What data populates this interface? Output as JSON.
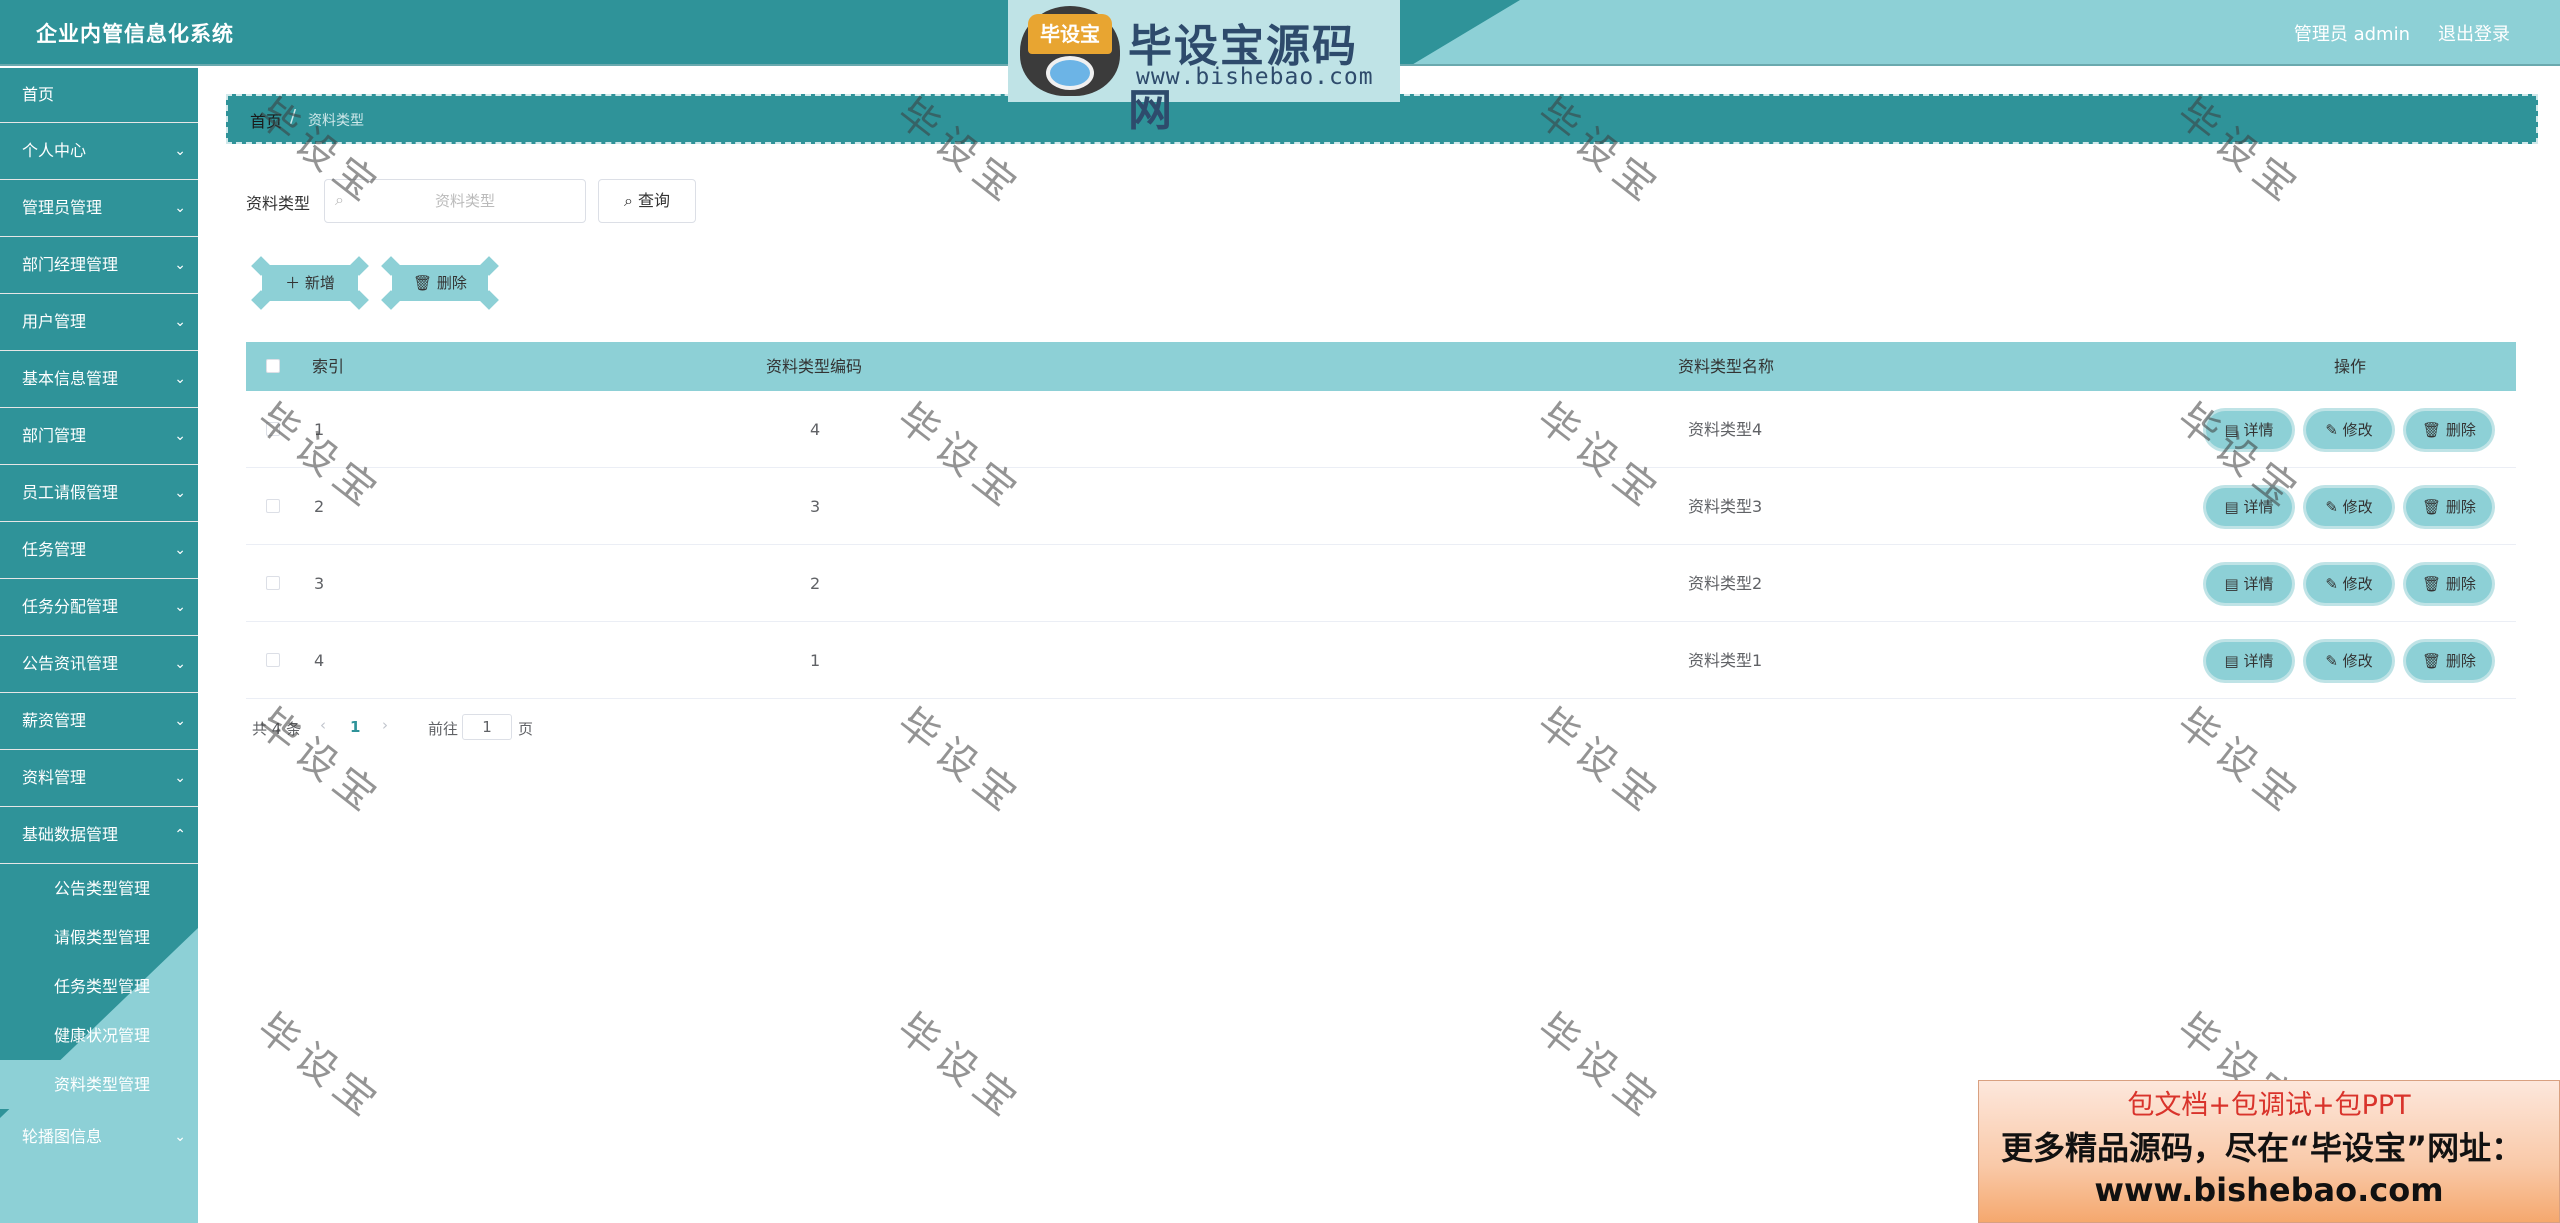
{
  "header": {
    "app_title": "企业内管信息化系统",
    "user_info": "管理员 admin",
    "logout": "退出登录"
  },
  "logo": {
    "badge": "毕设宝",
    "name": "毕设宝源码网",
    "url": "www.bishebao.com"
  },
  "sidebar": {
    "items": [
      {
        "label": "首页"
      },
      {
        "label": "个人中心"
      },
      {
        "label": "管理员管理"
      },
      {
        "label": "部门经理管理"
      },
      {
        "label": "用户管理"
      },
      {
        "label": "基本信息管理"
      },
      {
        "label": "部门管理"
      },
      {
        "label": "员工请假管理"
      },
      {
        "label": "任务管理"
      },
      {
        "label": "任务分配管理"
      },
      {
        "label": "公告资讯管理"
      },
      {
        "label": "薪资管理"
      },
      {
        "label": "资料管理"
      },
      {
        "label": "基础数据管理"
      }
    ],
    "subitems": [
      {
        "label": "公告类型管理"
      },
      {
        "label": "请假类型管理"
      },
      {
        "label": "任务类型管理"
      },
      {
        "label": "健康状况管理"
      },
      {
        "label": "资料类型管理"
      }
    ],
    "last_item": {
      "label": "轮播图信息"
    },
    "chevron": "⌄"
  },
  "breadcrumb": {
    "home": "首页",
    "separator": "/",
    "current": "资料类型"
  },
  "search": {
    "label": "资料类型",
    "placeholder": "资料类型",
    "query_button": "查询"
  },
  "actions": {
    "add_label": "新增",
    "delete_label": "删除"
  },
  "table": {
    "headers": {
      "index": "索引",
      "code": "资料类型编码",
      "name": "资料类型名称",
      "ops": "操作"
    },
    "rows": [
      {
        "index": "1",
        "code": "4",
        "name": "资料类型4"
      },
      {
        "index": "2",
        "code": "3",
        "name": "资料类型3"
      },
      {
        "index": "3",
        "code": "2",
        "name": "资料类型2"
      },
      {
        "index": "4",
        "code": "1",
        "name": "资料类型1"
      }
    ],
    "row_buttons": {
      "detail": "详情",
      "edit": "修改",
      "delete": "删除"
    }
  },
  "pagination": {
    "total": "共 4 条",
    "current_page": "1",
    "goto_label": "前往",
    "goto_value": "1",
    "page_unit": "页"
  },
  "watermark": {
    "text": "毕设宝"
  },
  "promo": {
    "line1": "包文档+包调试+包PPT",
    "line2": "更多精品源码，尽在“毕设宝”网址：",
    "line3": "www.bishebao.com"
  },
  "colors": {
    "primary_dark": "#2f9399",
    "primary_light": "#8dd0d6"
  }
}
